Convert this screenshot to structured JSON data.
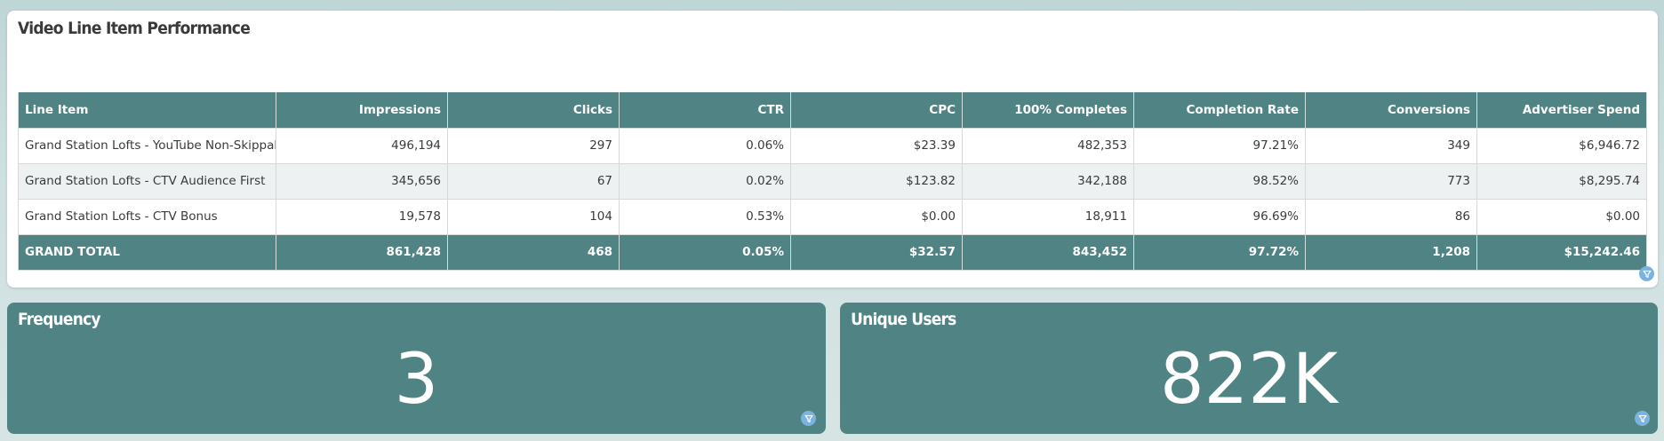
{
  "table_panel": {
    "title": "Video Line Item Performance",
    "columns": [
      "Line Item",
      "Impressions",
      "Clicks",
      "CTR",
      "CPC",
      "100% Completes",
      "Completion Rate",
      "Conversions",
      "Advertiser Spend"
    ],
    "rows": [
      [
        "Grand Station Lofts - YouTube Non-Skippable",
        "496,194",
        "297",
        "0.06%",
        "$23.39",
        "482,353",
        "97.21%",
        "349",
        "$6,946.72"
      ],
      [
        "Grand Station Lofts - CTV Audience First",
        "345,656",
        "67",
        "0.02%",
        "$123.82",
        "342,188",
        "98.52%",
        "773",
        "$8,295.74"
      ],
      [
        "Grand Station Lofts - CTV Bonus",
        "19,578",
        "104",
        "0.53%",
        "$0.00",
        "18,911",
        "96.69%",
        "86",
        "$0.00"
      ]
    ],
    "total": [
      "GRAND TOTAL",
      "861,428",
      "468",
      "0.05%",
      "$32.57",
      "843,452",
      "97.72%",
      "1,208",
      "$15,242.46"
    ]
  },
  "frequency_panel": {
    "title": "Frequency",
    "value": "3"
  },
  "unique_users_panel": {
    "title": "Unique Users",
    "value": "822K"
  },
  "colors": {
    "header_teal": "#508383",
    "filter_icon_blue": "#7ab3e0",
    "row_alt": "#eef1f1"
  },
  "icons": {
    "filter": "filter-icon"
  }
}
